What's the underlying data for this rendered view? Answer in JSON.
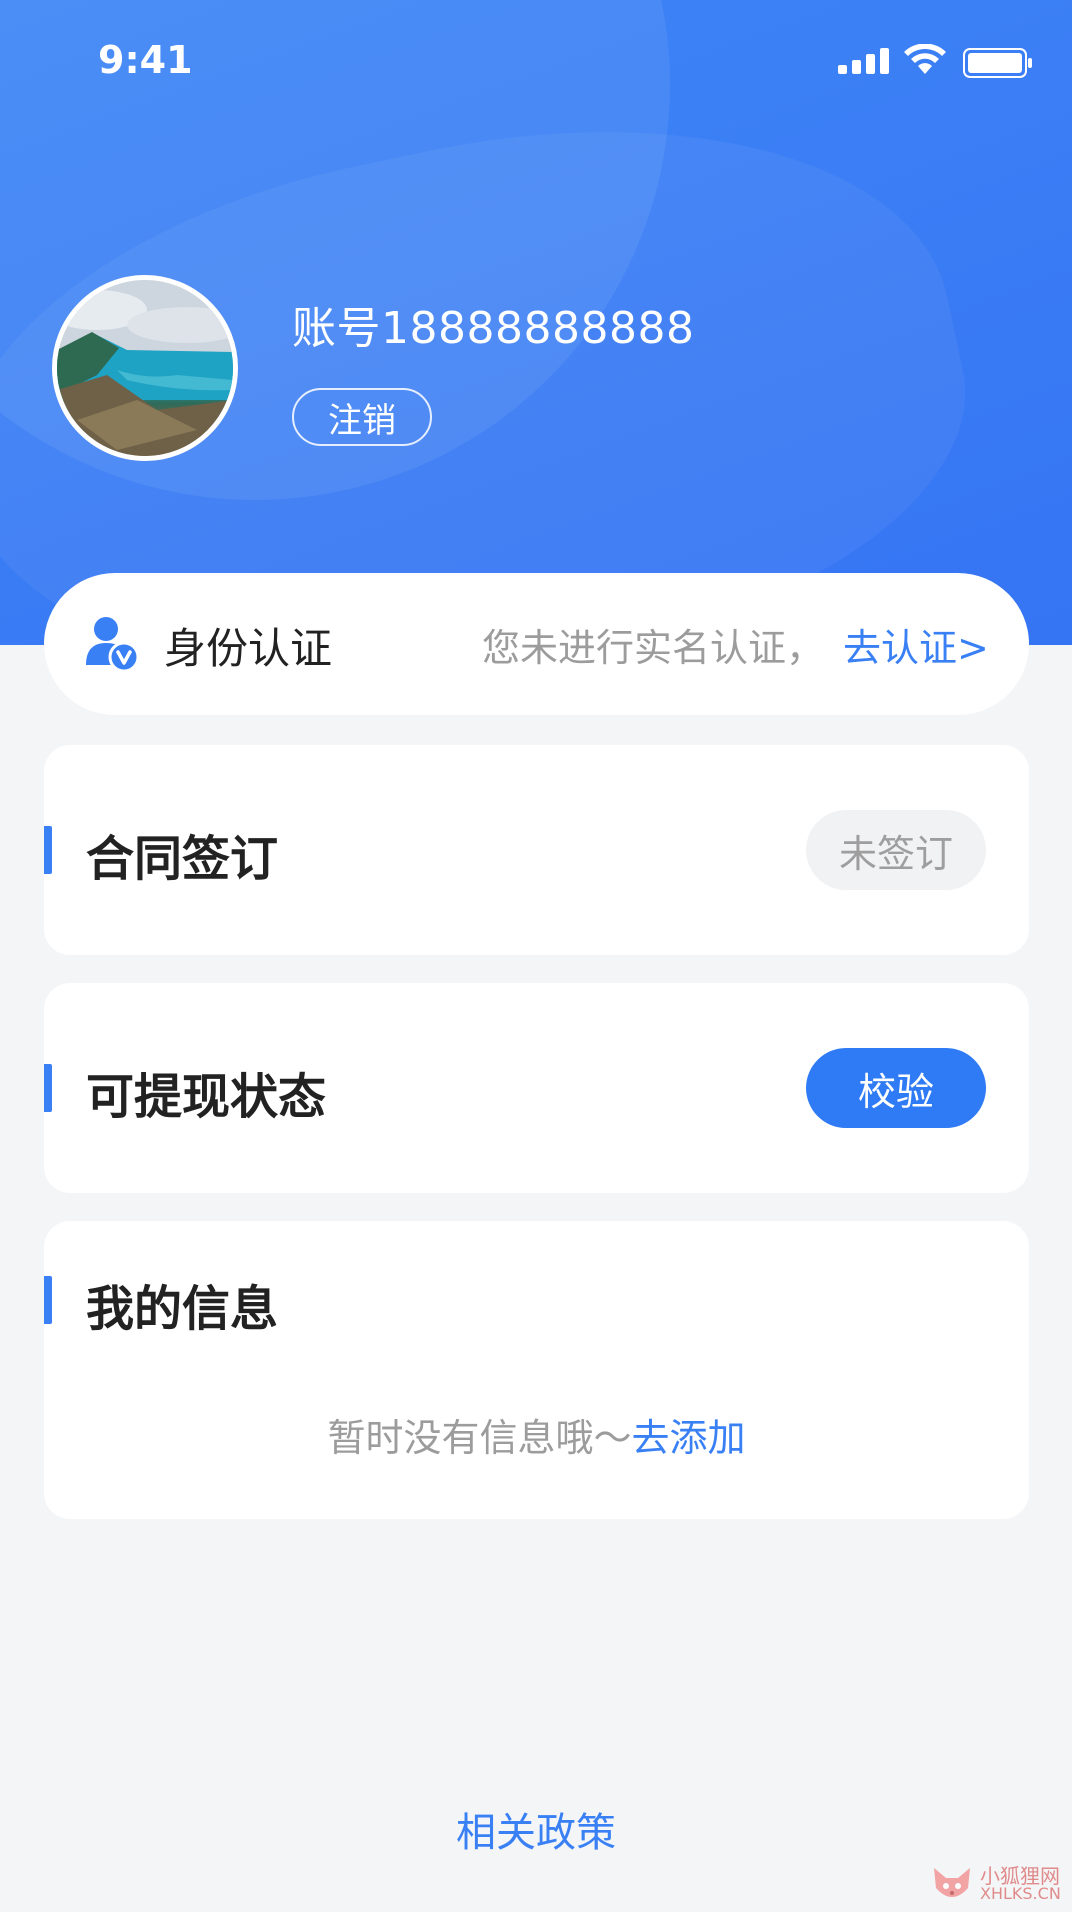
{
  "status_bar": {
    "time": "9:41"
  },
  "profile": {
    "account": "账号18888888888",
    "logout_label": "注销"
  },
  "identity": {
    "title": "身份认证",
    "hint": "您未进行实名认证，",
    "action": "去认证>"
  },
  "contract": {
    "title": "合同签订",
    "status": "未签订"
  },
  "withdraw": {
    "title": "可提现状态",
    "button": "校验"
  },
  "my_info": {
    "title": "我的信息",
    "empty_text": "暂时没有信息哦～",
    "add_link": "去添加"
  },
  "footer": {
    "policy_link": "相关政策"
  },
  "watermark": {
    "cn": "小狐狸网",
    "en": "XHLKS.CN"
  },
  "colors": {
    "primary": "#3a80f5",
    "header_gradient": "#3d86f6",
    "background": "#f4f5f7"
  }
}
